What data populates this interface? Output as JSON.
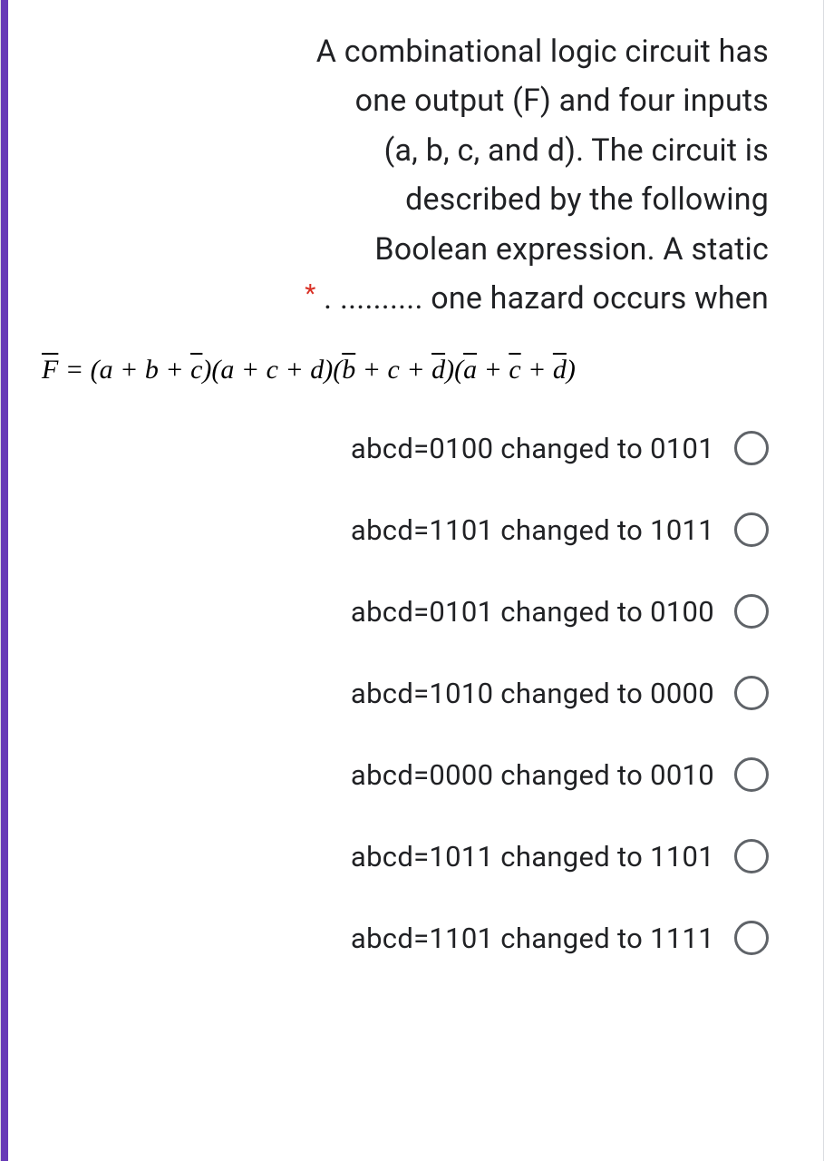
{
  "question": {
    "text_line1": "A combinational logic circuit has",
    "text_line2": "one output (F) and four inputs",
    "text_line3": "(a, b, c, and d). The circuit is",
    "text_line4": "described by the following",
    "text_line5": "Boolean expression. A static",
    "text_line6": ". .......... one hazard occurs when",
    "required_marker": "*"
  },
  "formula": {
    "lhs_var": "F",
    "equals": " = ",
    "term1_a": "a",
    "term1_plus1": " + ",
    "term1_b": "b",
    "term1_plus2": " + ",
    "term1_c": "c",
    "term2_a": "a",
    "term2_plus1": " + ",
    "term2_c": "c",
    "term2_plus2": " + ",
    "term2_d": "d",
    "term3_b": "b",
    "term3_plus1": " + ",
    "term3_c": "c",
    "term3_plus2": " + ",
    "term3_d": "d",
    "term4_a": "a",
    "term4_plus1": " + ",
    "term4_c": "c",
    "term4_plus2": " + ",
    "term4_d": "d",
    "open": "(",
    "close": ")"
  },
  "options": [
    {
      "label": "abcd=0100 changed to 0101"
    },
    {
      "label": "abcd=1101 changed to 1011"
    },
    {
      "label": "abcd=0101 changed to 0100"
    },
    {
      "label": "abcd=1010 changed to 0000"
    },
    {
      "label": "abcd=0000 changed to 0010"
    },
    {
      "label": "abcd=1011 changed to 1101"
    },
    {
      "label": "abcd=1101 changed to 1111"
    }
  ]
}
